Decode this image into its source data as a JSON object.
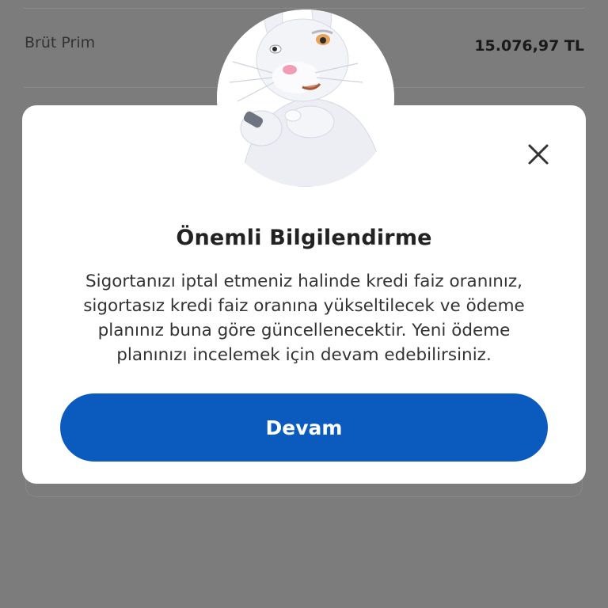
{
  "background": {
    "row_label": "Brüt Prim",
    "row_value": "15.076,97 TL"
  },
  "modal": {
    "title": "Önemli Bilgilendirme",
    "message": "Sigortanızı iptal etmeniz halinde kredi faiz oranınız, sigortasız kredi faiz oranına yükseltilecek ve ödeme planınız buna göre güncellenecektir. Yeni ödeme planınızı incelemek için devam edebilirsiniz.",
    "continue_label": "Devam",
    "close_icon": "close-icon",
    "mascot": "rabbit-mascot"
  },
  "colors": {
    "overlay": "#7c7c7c",
    "primary": "#0a5bbd",
    "modal_bg": "#ffffff"
  }
}
